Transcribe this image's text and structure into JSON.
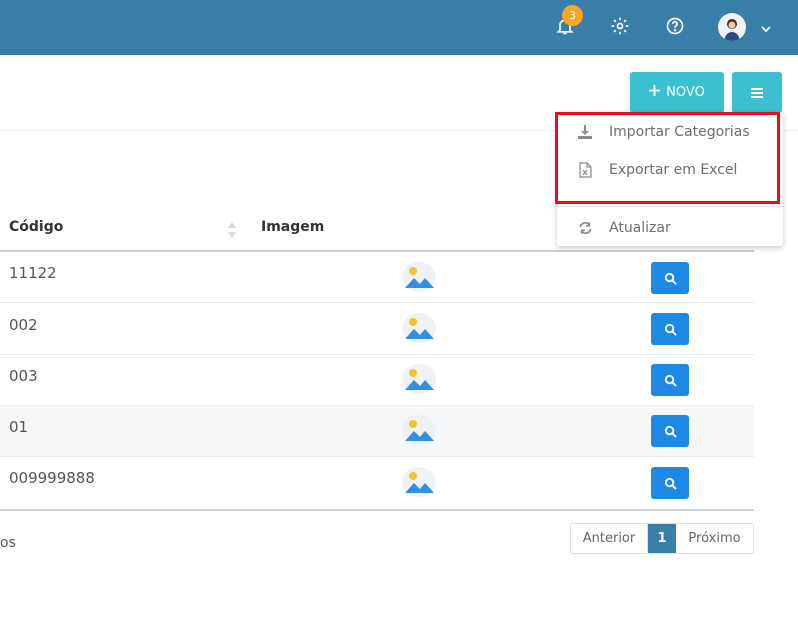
{
  "topbar": {
    "notifications_count": "3",
    "icons": [
      "bell-icon",
      "gear-icon",
      "help-icon",
      "avatar",
      "chevron-down-icon"
    ],
    "color": "#3a7fa8"
  },
  "toolbar": {
    "novo_label": "NOVO",
    "accent": "#3cc0cf"
  },
  "dropdown": {
    "items": [
      {
        "label": "Importar Categorias",
        "icon": "download-icon"
      },
      {
        "label": "Exportar em Excel",
        "icon": "excel-file-icon"
      },
      {
        "label": "Atualizar",
        "icon": "refresh-icon"
      }
    ],
    "highlight_color": "#e0121b"
  },
  "table": {
    "headers": {
      "codigo": "Código",
      "imagem": "Imagem"
    },
    "rows": [
      {
        "codigo": "11122"
      },
      {
        "codigo": "002"
      },
      {
        "codigo": "003"
      },
      {
        "codigo": "01"
      },
      {
        "codigo": "009999888"
      }
    ]
  },
  "footer": {
    "info_fragment": "os",
    "pagination": {
      "prev": "Anterior",
      "current": "1",
      "next": "Próximo"
    }
  }
}
